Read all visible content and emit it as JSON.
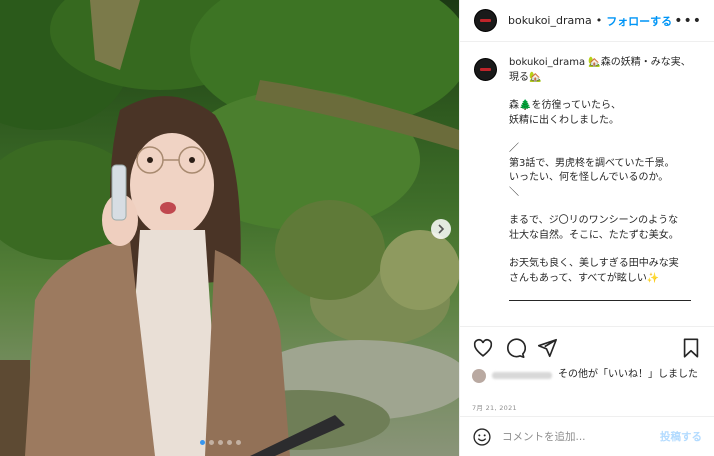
{
  "header": {
    "username": "bokukoi_drama",
    "separator": "•",
    "follow_label": "フォローする",
    "more_label": "•••"
  },
  "caption": {
    "username": "bokukoi_drama",
    "title": "🏡森の妖精・みな実、現る🏡",
    "paragraphs": [
      "森🌲を彷徨っていたら、\n妖精に出くわしました。",
      "／\n第3話で、男虎柊を調べていた千景。\nいったい、何を怪しんでいるのか。\n＼",
      "まるで、ジ〇リのワンシーンのような\n壮大な自然。そこに、たたずむ美女。",
      "お天気も良く、美しすぎる田中みな実\nさんもあって、すべてが眩しい✨"
    ]
  },
  "likes": {
    "text": "その他が「いいね！」しました"
  },
  "date": "7月 21, 2021",
  "comment": {
    "placeholder": "コメントを追加...",
    "post_label": "投稿する"
  },
  "icons": {
    "like": "heart-icon",
    "comment": "comment-icon",
    "share": "share-icon",
    "save": "bookmark-icon",
    "emoji": "emoji-icon",
    "next": "chevron-right-icon"
  },
  "colors": {
    "accent": "#0095f6",
    "post_disabled": "#b3dbff",
    "carousel_active": "#3897f0"
  },
  "carousel": {
    "count": 5,
    "active_index": 0
  }
}
